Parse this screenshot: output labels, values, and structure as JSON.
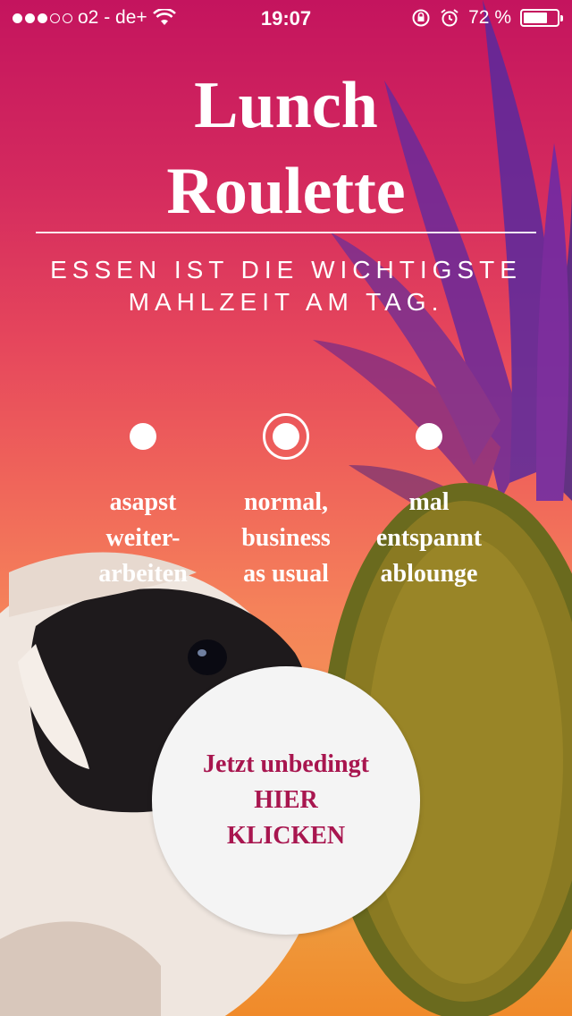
{
  "status_bar": {
    "signal_dots_filled": 3,
    "signal_dots_total": 5,
    "carrier": "o2 - de+",
    "time": "19:07",
    "battery_percent_label": "72 %",
    "battery_level": 0.72,
    "icons": [
      "wifi-icon",
      "rotation-lock-icon",
      "alarm-icon",
      "battery-icon"
    ]
  },
  "title": {
    "line1": "Lunch",
    "line2": "Roulette"
  },
  "subtitle": {
    "line1": "ESSEN IST DIE WICHTIGSTE",
    "line2": "MAHLZEIT AM TAG."
  },
  "options": [
    {
      "lines": [
        "asapst",
        "weiter-",
        "arbeiten"
      ],
      "selected": false
    },
    {
      "lines": [
        "normal,",
        "business",
        "as usual"
      ],
      "selected": true
    },
    {
      "lines": [
        "mal",
        "entspannt",
        "ablounge"
      ],
      "selected": false
    }
  ],
  "cta": {
    "line1": "Jetzt unbedingt",
    "line2": "HIER",
    "line3": "KLICKEN"
  },
  "colors": {
    "accent": "#a8164f",
    "gradient_top": "#c4145e",
    "gradient_bottom": "#f08a2a",
    "button_bg": "#f4f4f4"
  }
}
